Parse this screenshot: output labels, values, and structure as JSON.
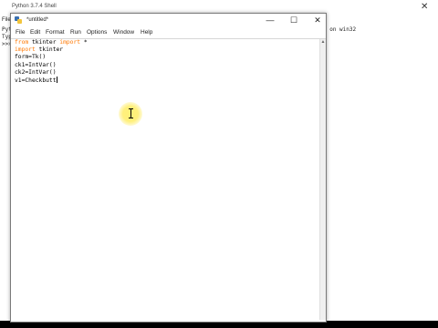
{
  "shell": {
    "title": "Python 3.7.4 Shell",
    "menu": "File",
    "body_lines": [
      "Pyt",
      "Typ",
      ">>>"
    ],
    "version_tail": "] on win32",
    "close_glyph": "✕"
  },
  "editor": {
    "title": "*untitled*",
    "menu": [
      "File",
      "Edit",
      "Format",
      "Run",
      "Options",
      "Window",
      "Help"
    ],
    "controls": {
      "minimize": "—",
      "maximize": "☐",
      "close": "✕"
    },
    "code": {
      "line1_kw1": "from",
      "line1_mid": " tkinter ",
      "line1_kw2": "import",
      "line1_end": " *",
      "line2_kw": "import",
      "line2_end": " tkinter",
      "line3": "form=Tk()",
      "line4": "ck1=IntVar()",
      "line5": "ck2=IntVar()",
      "line6": "v1=Checkbutt"
    }
  },
  "colors": {
    "keyword": "#ff7700",
    "cursor_highlight": "#ffee6e"
  }
}
